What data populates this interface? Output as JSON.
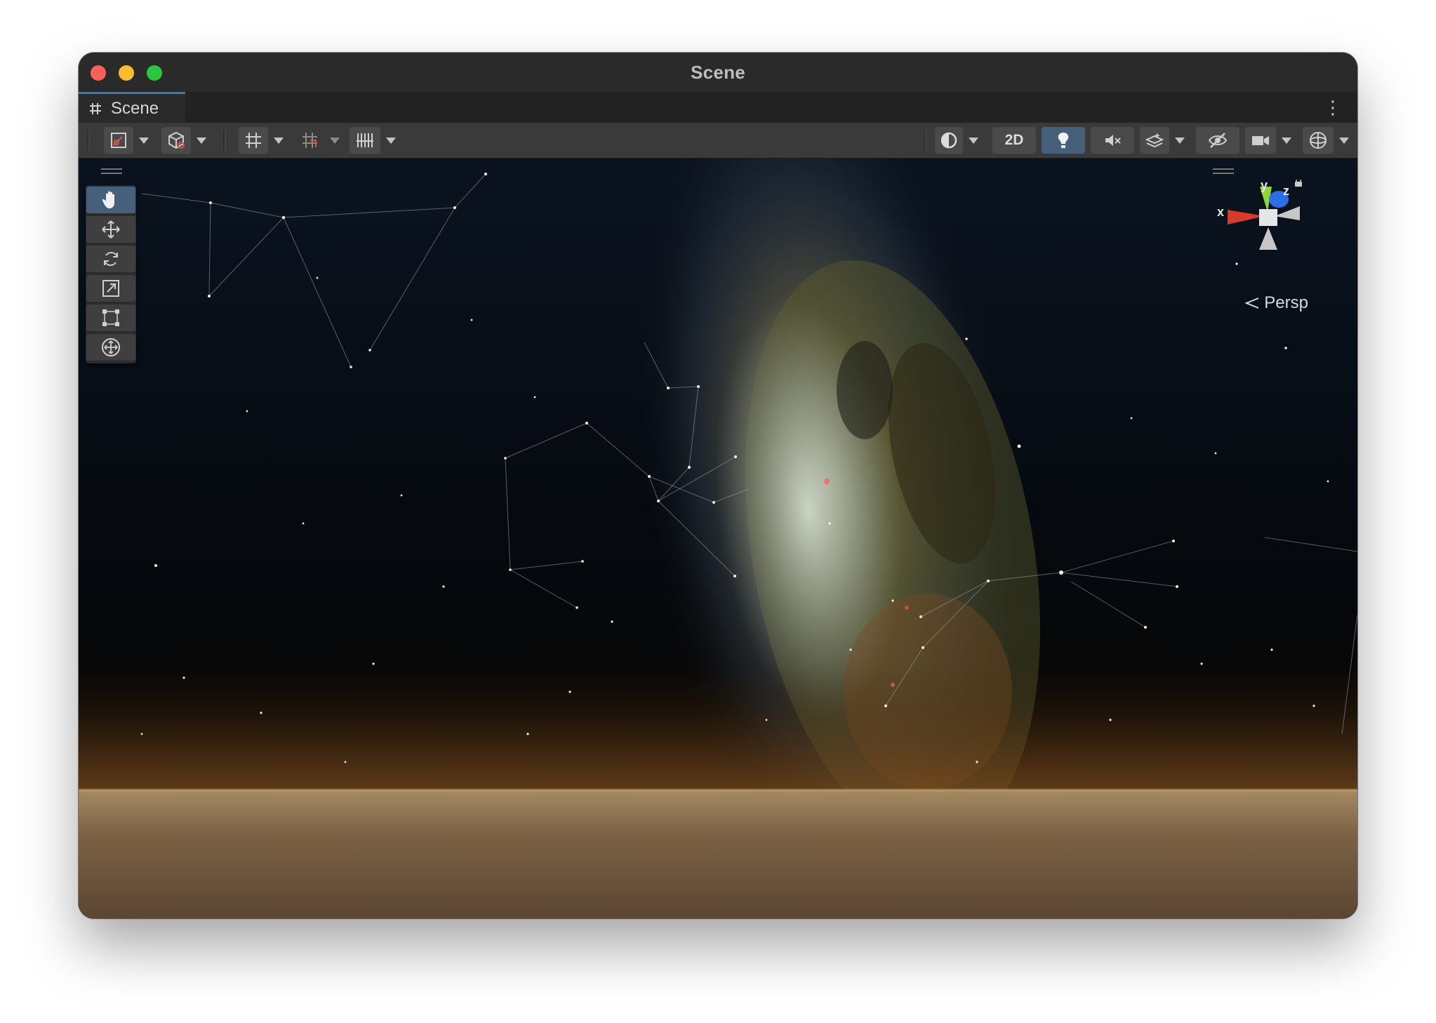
{
  "window": {
    "title": "Scene"
  },
  "tab": {
    "label": "Scene",
    "icon": "grid-hash-icon"
  },
  "toolbar": {
    "two_d_label": "2D",
    "buttons": [
      "transform-handle-icon",
      "global-local-icon",
      "grid-snapping-icon",
      "incremental-snap-icon",
      "grid-visibility-icon",
      "draw-mode-icon",
      "lighting-icon",
      "audio-mute-icon",
      "effects-icon",
      "scene-visibility-icon",
      "camera-icon",
      "gizmos-icon"
    ]
  },
  "tools": [
    "view-tool-hand",
    "move-tool",
    "rotate-tool",
    "scale-tool",
    "rect-tool",
    "transform-tool"
  ],
  "gizmo": {
    "x_label": "x",
    "y_label": "y",
    "z_label": "z",
    "projection_label": "Persp"
  },
  "colors": {
    "accent": "#46607c",
    "tab_highlight": "#3a79bb",
    "axis_x": "#d83a2c",
    "axis_y": "#8fd63a",
    "axis_z": "#2d6ee8"
  }
}
